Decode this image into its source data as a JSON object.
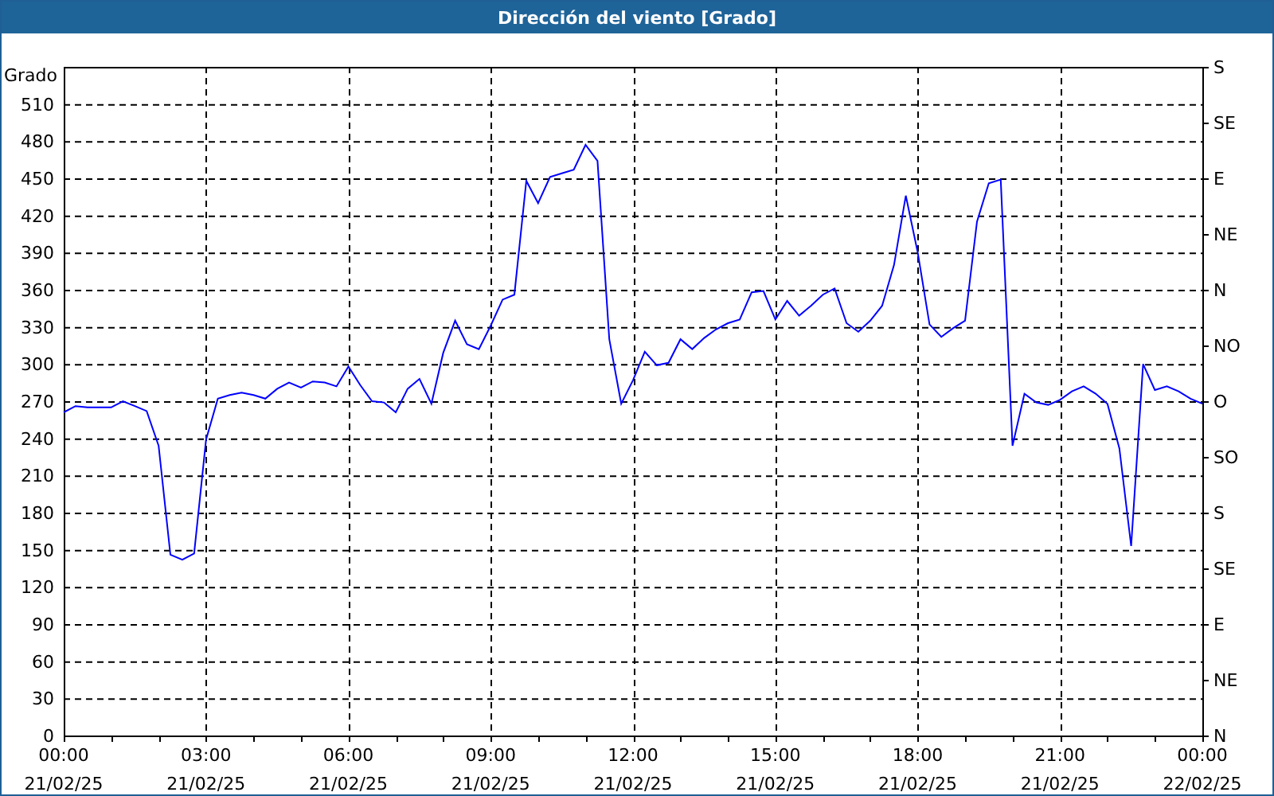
{
  "window": {
    "title": "Dirección del viento [Grado]"
  },
  "chart": {
    "chart_data": {
      "type": "line",
      "ylabel": "Grado",
      "categories": [
        "00:00 21/02/25",
        null,
        null,
        null,
        null,
        null,
        null,
        null,
        null,
        null,
        null,
        null,
        "03:00 21/02/25",
        null,
        null,
        null,
        null,
        null,
        null,
        null,
        null,
        null,
        null,
        null,
        "06:00 21/02/25",
        null,
        null,
        null,
        null,
        null,
        null,
        null,
        null,
        null,
        null,
        null,
        "09:00 21/02/25",
        null,
        null,
        null,
        null,
        null,
        null,
        null,
        null,
        null,
        null,
        null,
        "12:00 21/02/25",
        null,
        null,
        null,
        null,
        null,
        null,
        null,
        null,
        null,
        null,
        null,
        "15:00 21/02/25",
        null,
        null,
        null,
        null,
        null,
        null,
        null,
        null,
        null,
        null,
        null,
        "18:00 21/02/25",
        null,
        null,
        null,
        null,
        null,
        null,
        null,
        null,
        null,
        null,
        null,
        "21:00 21/02/25",
        null,
        null,
        null,
        null,
        null,
        null,
        null,
        null,
        null,
        null,
        null,
        "00:00 22/02/25"
      ],
      "series": [
        {
          "color": "#0000ff",
          "values": [
            261,
            266,
            265,
            265,
            265,
            270,
            266,
            262,
            234,
            146,
            142,
            147,
            239,
            272,
            275,
            277,
            275,
            272,
            280,
            285,
            281,
            286,
            285,
            282,
            298,
            283,
            270,
            269,
            261,
            280,
            288,
            268,
            309,
            335,
            316,
            312,
            331,
            352,
            356,
            448,
            430,
            451,
            454,
            457,
            477,
            464,
            320,
            268,
            287,
            310,
            299,
            301,
            320,
            312,
            321,
            328,
            333,
            336,
            358,
            359,
            336,
            351,
            339,
            347,
            356,
            361,
            333,
            326,
            335,
            347,
            380,
            436,
            390,
            332,
            322,
            329,
            335,
            415,
            446,
            449,
            234,
            276,
            269,
            267,
            271,
            278,
            282,
            276,
            268,
            232,
            153,
            300,
            279,
            282,
            278,
            272,
            268
          ]
        }
      ],
      "ylim": [
        0,
        540
      ],
      "grid": true,
      "yticks": [
        0,
        30,
        60,
        90,
        120,
        150,
        180,
        210,
        240,
        270,
        300,
        330,
        360,
        390,
        420,
        450,
        480,
        510
      ]
    },
    "secondary_axis_labels": [
      "S",
      "SE",
      "E",
      "NE",
      "N",
      "NO",
      "O",
      "SO",
      "S",
      "SE",
      "E",
      "NE",
      "N"
    ]
  }
}
